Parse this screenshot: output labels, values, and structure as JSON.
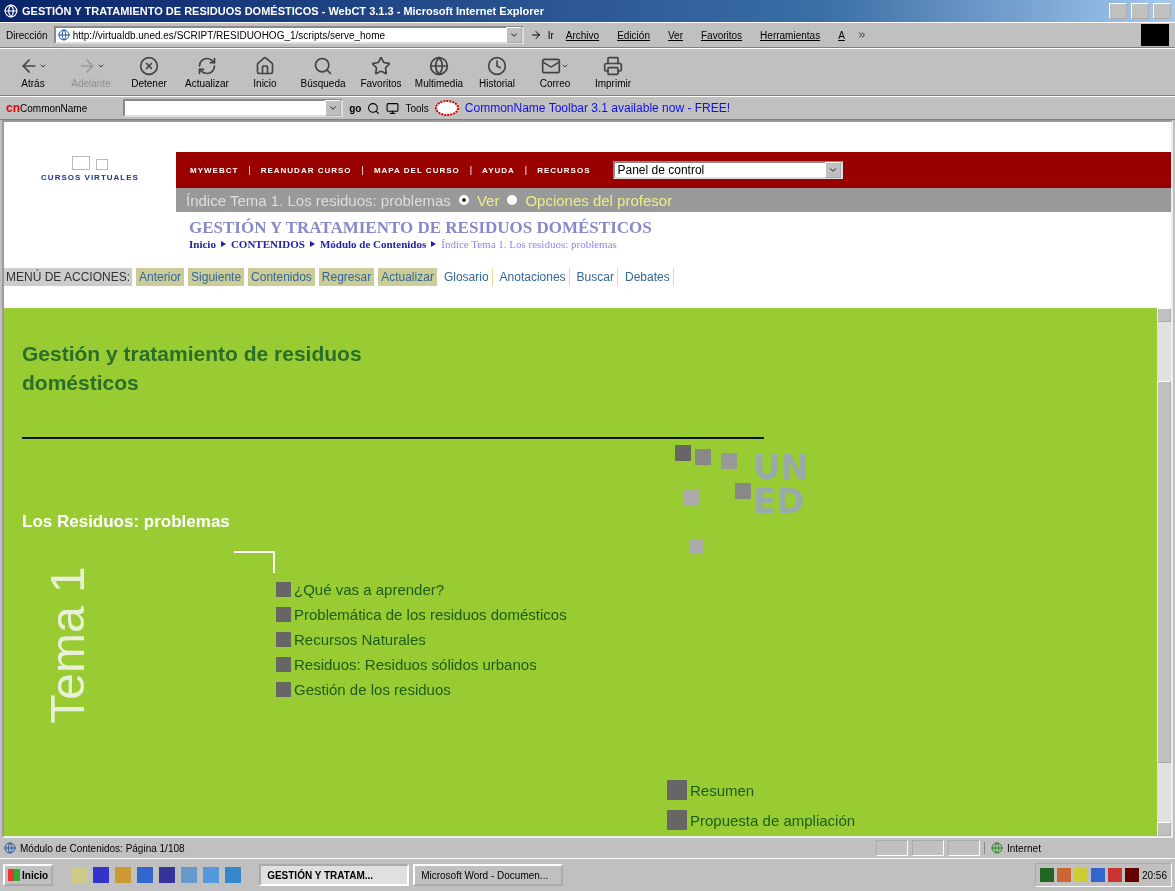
{
  "window": {
    "title": "GESTIÓN Y TRATAMIENTO DE RESIDUOS DOMÉSTICOS - WebCT 3.1.3 - Microsoft Internet Explorer"
  },
  "address_bar": {
    "label": "Dirección",
    "url": "http://virtualdb.uned.es/SCRIPT/RESIDUOHOG_1/scripts/serve_home",
    "go": "Ir"
  },
  "menu": [
    "Archivo",
    "Edición",
    "Ver",
    "Favoritos",
    "Herramientas",
    "A"
  ],
  "toolbar": [
    {
      "label": "Atrás",
      "kind": "back",
      "disabled": false,
      "dropdown": true
    },
    {
      "label": "Adelante",
      "kind": "forward",
      "disabled": true,
      "dropdown": true
    },
    {
      "label": "Detener",
      "kind": "stop",
      "disabled": false,
      "dropdown": false
    },
    {
      "label": "Actualizar",
      "kind": "refresh",
      "disabled": false,
      "dropdown": false
    },
    {
      "label": "Inicio",
      "kind": "home",
      "disabled": false,
      "dropdown": false
    },
    {
      "label": "Búsqueda",
      "kind": "search",
      "disabled": false,
      "dropdown": false
    },
    {
      "label": "Favoritos",
      "kind": "favorites",
      "disabled": false,
      "dropdown": false
    },
    {
      "label": "Multimedia",
      "kind": "media",
      "disabled": false,
      "dropdown": false
    },
    {
      "label": "Historial",
      "kind": "history",
      "disabled": false,
      "dropdown": false
    },
    {
      "label": "Correo",
      "kind": "mail",
      "disabled": false,
      "dropdown": true
    },
    {
      "label": "Imprimir",
      "kind": "print",
      "disabled": false,
      "dropdown": false
    }
  ],
  "commonname_bar": {
    "logo": "cn",
    "name": "CommonName",
    "go": "go",
    "tools": "Tools",
    "promo": "CommonName Toolbar 3.1 available now - FREE!"
  },
  "course_header": {
    "logo_text": "CURSOS VIRTUALES",
    "nav": [
      "MYWEBCT",
      "REANUDAR CURSO",
      "MAPA DEL CURSO",
      "AYUDA",
      "RECURSOS"
    ],
    "separator": "|",
    "select": "Panel de control"
  },
  "view_bar": {
    "title": "Índice Tema 1. Los residuos: problemas",
    "options": [
      {
        "label": "Ver",
        "selected": true
      },
      {
        "label": "Opciones del profesor",
        "selected": false
      }
    ]
  },
  "course_title": "GESTIÓN Y TRATAMIENTO DE RESIDUOS DOMÉSTICOS",
  "breadcrumb": [
    {
      "label": "Inicio",
      "current": false
    },
    {
      "label": "CONTENIDOS",
      "current": false
    },
    {
      "label": "Módulo de Contenidos",
      "current": false
    },
    {
      "label": "Índice Tema 1. Los residuos: problemas",
      "current": true
    }
  ],
  "actions": {
    "label": "MENÚ DE ACCIONES:",
    "items": [
      {
        "label": "Anterior",
        "kind": "button"
      },
      {
        "label": "Siguiente",
        "kind": "button"
      },
      {
        "label": "Contenidos",
        "kind": "button"
      },
      {
        "label": "Regresar",
        "kind": "button"
      },
      {
        "label": "Actualizar",
        "kind": "button"
      },
      {
        "label": "Glosario",
        "kind": "link"
      },
      {
        "label": "Anotaciones",
        "kind": "link"
      },
      {
        "label": "Buscar",
        "kind": "link"
      },
      {
        "label": "Debates",
        "kind": "link"
      }
    ]
  },
  "content": {
    "heading": "Gestión y tratamiento de residuos domésticos",
    "uned_logo": [
      "UN",
      "ED"
    ],
    "section": "Los Residuos: problemas",
    "tema": "Tema 1",
    "topics": [
      "¿Qué vas a aprender?",
      "Problemática de los residuos domésticos",
      "Recursos Naturales",
      "Residuos: Residuos sólidos urbanos",
      "Gestión de los residuos"
    ],
    "extras": [
      "Resumen",
      "Propuesta de ampliación"
    ]
  },
  "status_bar": {
    "text": "Módulo de Contenidos: Página 1/108",
    "zone": "Internet"
  },
  "taskbar": {
    "start": "Inicio",
    "tasks": [
      {
        "label": "GESTIÓN Y TRATAM...",
        "selected": true
      },
      {
        "label": "Microsoft Word - Documen...",
        "selected": false
      }
    ],
    "clock": "20:56"
  }
}
